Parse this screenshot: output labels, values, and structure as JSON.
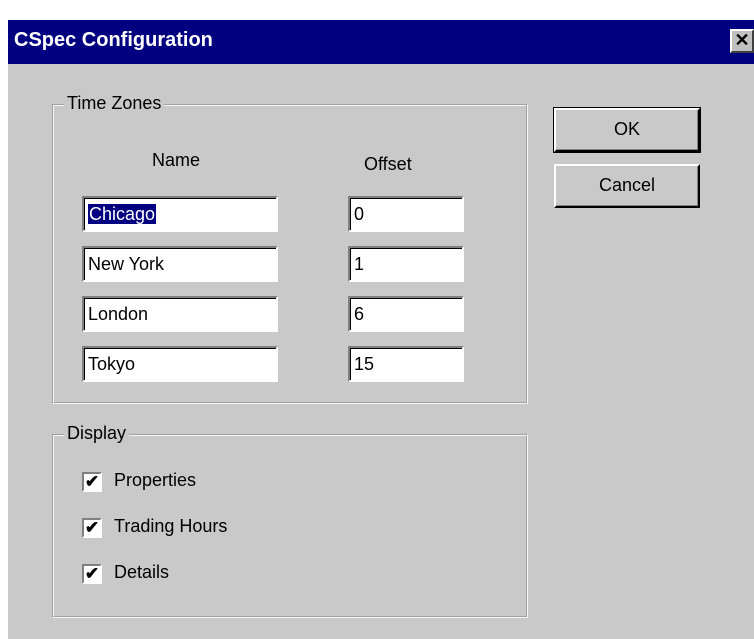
{
  "window": {
    "title": "CSpec Configuration",
    "close_glyph": "✕",
    "close_icon": "close-icon"
  },
  "time_zones": {
    "label": "Time Zones",
    "name_header": "Name",
    "offset_header": "Offset",
    "rows": [
      {
        "name": "Chicago",
        "offset": "0",
        "selected": true
      },
      {
        "name": "New York",
        "offset": "1"
      },
      {
        "name": "London",
        "offset": "6"
      },
      {
        "name": "Tokyo",
        "offset": "15"
      }
    ]
  },
  "display": {
    "label": "Display",
    "options": [
      {
        "label": "Properties",
        "checked": true
      },
      {
        "label": "Trading Hours",
        "checked": true
      },
      {
        "label": "Details",
        "checked": true
      }
    ]
  },
  "buttons": {
    "ok": "OK",
    "cancel": "Cancel"
  },
  "colors": {
    "title_bar": "#000080",
    "dialog_face": "#c9c9c9",
    "selection": "#000080"
  }
}
